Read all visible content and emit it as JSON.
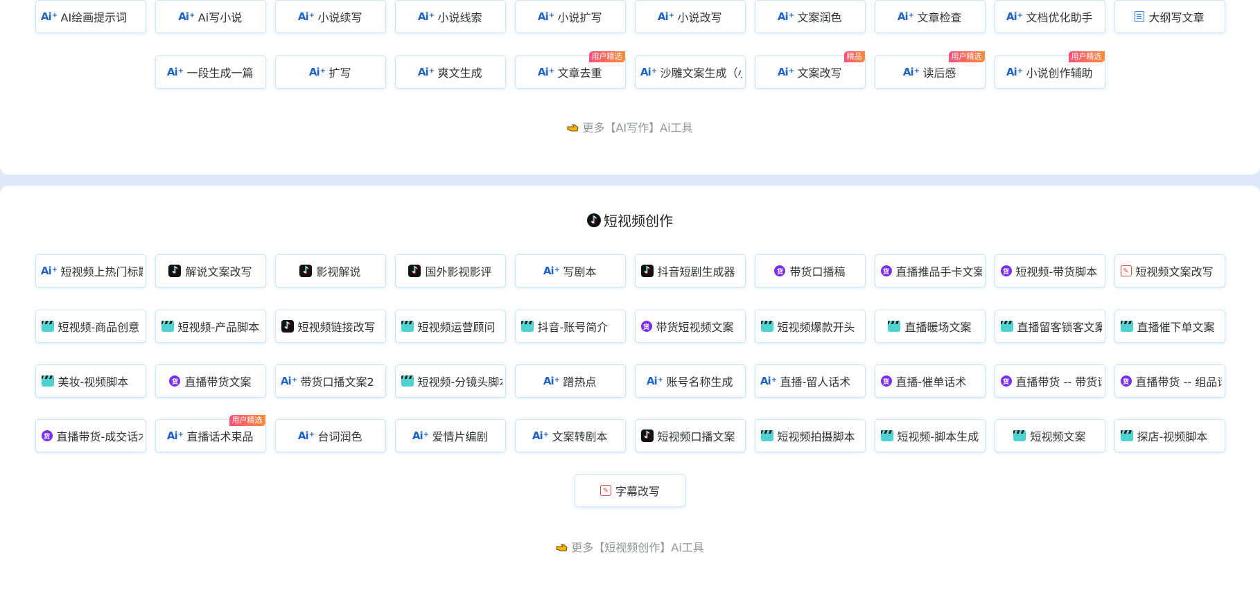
{
  "ai_writing": {
    "rows": [
      [
        {
          "label": "AI绘画提示词",
          "icon": "ai-icon"
        },
        {
          "label": "Ai写小说",
          "icon": "ai-icon"
        },
        {
          "label": "小说续写",
          "icon": "ai-icon"
        },
        {
          "label": "小说线索",
          "icon": "ai-icon"
        },
        {
          "label": "小说扩写",
          "icon": "ai-icon"
        },
        {
          "label": "小说改写",
          "icon": "ai-icon"
        },
        {
          "label": "文案润色",
          "icon": "ai-icon"
        },
        {
          "label": "文章检查",
          "icon": "ai-icon"
        },
        {
          "label": "文档优化助手",
          "icon": "ai-icon"
        },
        {
          "label": "大纲写文章",
          "icon": "document-icon"
        }
      ],
      [
        {
          "label": "一段生成一篇",
          "icon": "ai-icon"
        },
        {
          "label": "扩写",
          "icon": "ai-icon"
        },
        {
          "label": "爽文生成",
          "icon": "ai-icon"
        },
        {
          "label": "文章去重",
          "icon": "ai-icon",
          "badge": "用户精选"
        },
        {
          "label": "沙雕文案生成（小",
          "icon": "ai-icon"
        },
        {
          "label": "文案改写",
          "icon": "ai-icon",
          "badge": "精品"
        },
        {
          "label": "读后感",
          "icon": "ai-icon",
          "badge": "用户精选"
        },
        {
          "label": "小说创作辅助",
          "icon": "ai-icon",
          "badge": "用户精选"
        }
      ]
    ],
    "more_label": "更多【AI写作】Ai工具"
  },
  "short_video": {
    "title": "短视频创作",
    "rows": [
      [
        {
          "label": "短视频上热门标题",
          "icon": "ai-icon"
        },
        {
          "label": "解说文案改写",
          "icon": "tiktok-icon"
        },
        {
          "label": "影视解说",
          "icon": "tiktok-icon"
        },
        {
          "label": "国外影视影评",
          "icon": "tiktok-icon"
        },
        {
          "label": "写剧本",
          "icon": "ai-icon"
        },
        {
          "label": "抖音短剧生成器",
          "icon": "tiktok-icon"
        },
        {
          "label": "带货口播稿",
          "icon": "huo-icon"
        },
        {
          "label": "直播推品手卡文案",
          "icon": "huo-icon"
        },
        {
          "label": "短视频-带货脚本",
          "icon": "huo-icon"
        },
        {
          "label": "短视频文案改写",
          "icon": "edit-icon"
        }
      ],
      [
        {
          "label": "短视频-商品创意",
          "icon": "clapper-icon"
        },
        {
          "label": "短视频-产品脚本",
          "icon": "clapper-icon"
        },
        {
          "label": "短视频链接改写",
          "icon": "tiktok-icon"
        },
        {
          "label": "短视频运营顾问",
          "icon": "clapper-icon"
        },
        {
          "label": "抖音-账号简介",
          "icon": "clapper-icon"
        },
        {
          "label": "带货短视频文案",
          "icon": "huo-icon"
        },
        {
          "label": "短视频爆款开头",
          "icon": "clapper-icon"
        },
        {
          "label": "直播暖场文案",
          "icon": "clapper-icon"
        },
        {
          "label": "直播留客锁客文案",
          "icon": "clapper-icon"
        },
        {
          "label": "直播催下单文案",
          "icon": "clapper-icon"
        }
      ],
      [
        {
          "label": "美妆-视频脚本",
          "icon": "clapper-icon"
        },
        {
          "label": "直播带货文案",
          "icon": "huo-icon"
        },
        {
          "label": "带货口播文案2",
          "icon": "ai-icon"
        },
        {
          "label": "短视频-分镜头脚本",
          "icon": "clapper-icon"
        },
        {
          "label": "蹭热点",
          "icon": "ai-icon"
        },
        {
          "label": "账号名称生成",
          "icon": "ai-icon"
        },
        {
          "label": "直播-留人话术",
          "icon": "ai-icon"
        },
        {
          "label": "直播-催单话术",
          "icon": "huo-icon"
        },
        {
          "label": "直播带货 -- 带货话术",
          "icon": "huo-icon"
        },
        {
          "label": "直播带货 -- 组品话术",
          "icon": "huo-icon"
        }
      ],
      [
        {
          "label": "直播带货-成交话术",
          "icon": "huo-icon"
        },
        {
          "label": "直播话术束品",
          "icon": "ai-icon",
          "badge": "用户精选"
        },
        {
          "label": "台词润色",
          "icon": "ai-icon"
        },
        {
          "label": "爱情片编剧",
          "icon": "ai-icon"
        },
        {
          "label": "文案转剧本",
          "icon": "ai-icon"
        },
        {
          "label": "短视频口播文案",
          "icon": "tiktok-icon"
        },
        {
          "label": "短视频拍摄脚本",
          "icon": "clapper-icon"
        },
        {
          "label": "短视频-脚本生成",
          "icon": "clapper-icon"
        },
        {
          "label": "短视频文案",
          "icon": "clapper-icon"
        },
        {
          "label": "探店-视频脚本",
          "icon": "clapper-icon"
        }
      ],
      [
        {
          "label": "字幕改写",
          "icon": "edit-icon"
        }
      ]
    ],
    "more_label": "更多【短视频创作】Ai工具"
  },
  "icon_glyphs": {
    "ai_text": "Ai",
    "ai_spark": "+",
    "tiktok_glyph": "♪",
    "huo_glyph": "货",
    "edit_glyph": "✎"
  }
}
